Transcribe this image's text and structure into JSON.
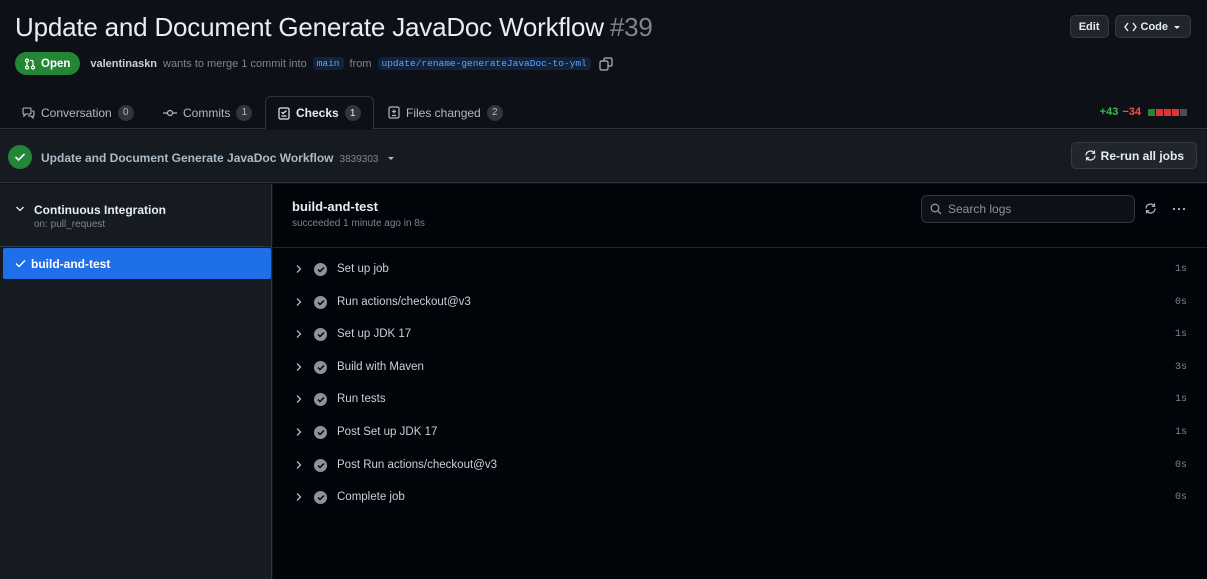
{
  "pr": {
    "title": "Update and Document Generate JavaDoc Workflow",
    "number": "#39",
    "state": "Open",
    "author": "valentinaskn",
    "meta_text": "wants to merge 1 commit into",
    "base_branch": "main",
    "from_text": "from",
    "head_branch": "update/rename-generateJavaDoc-to-yml"
  },
  "header_buttons": {
    "edit": "Edit",
    "code": "Code"
  },
  "tabs": [
    {
      "label": "Conversation",
      "count": "0"
    },
    {
      "label": "Commits",
      "count": "1"
    },
    {
      "label": "Checks",
      "count": "1"
    },
    {
      "label": "Files changed",
      "count": "2"
    }
  ],
  "diffstat": {
    "additions": "+43",
    "deletions": "−34"
  },
  "workflow": {
    "title": "Update and Document Generate JavaDoc Workflow",
    "sha": "3839303",
    "rerun_label": "Re-run all jobs"
  },
  "sidebar": {
    "group_title": "Continuous Integration",
    "group_trigger": "on: pull_request",
    "job": "build-and-test"
  },
  "job": {
    "title": "build-and-test",
    "status": "succeeded 1 minute ago in 8s",
    "search_placeholder": "Search logs"
  },
  "steps": [
    {
      "name": "Set up job",
      "duration": "1s"
    },
    {
      "name": "Run actions/checkout@v3",
      "duration": "0s"
    },
    {
      "name": "Set up JDK 17",
      "duration": "1s"
    },
    {
      "name": "Build with Maven",
      "duration": "3s"
    },
    {
      "name": "Run tests",
      "duration": "1s"
    },
    {
      "name": "Post Set up JDK 17",
      "duration": "1s"
    },
    {
      "name": "Post Run actions/checkout@v3",
      "duration": "0s"
    },
    {
      "name": "Complete job",
      "duration": "0s"
    }
  ],
  "colors": {
    "background": "#0d1117",
    "success": "#238636",
    "accent": "#1f6feb",
    "link": "#58a6ff",
    "addition": "#3fb950",
    "deletion": "#f85149"
  }
}
